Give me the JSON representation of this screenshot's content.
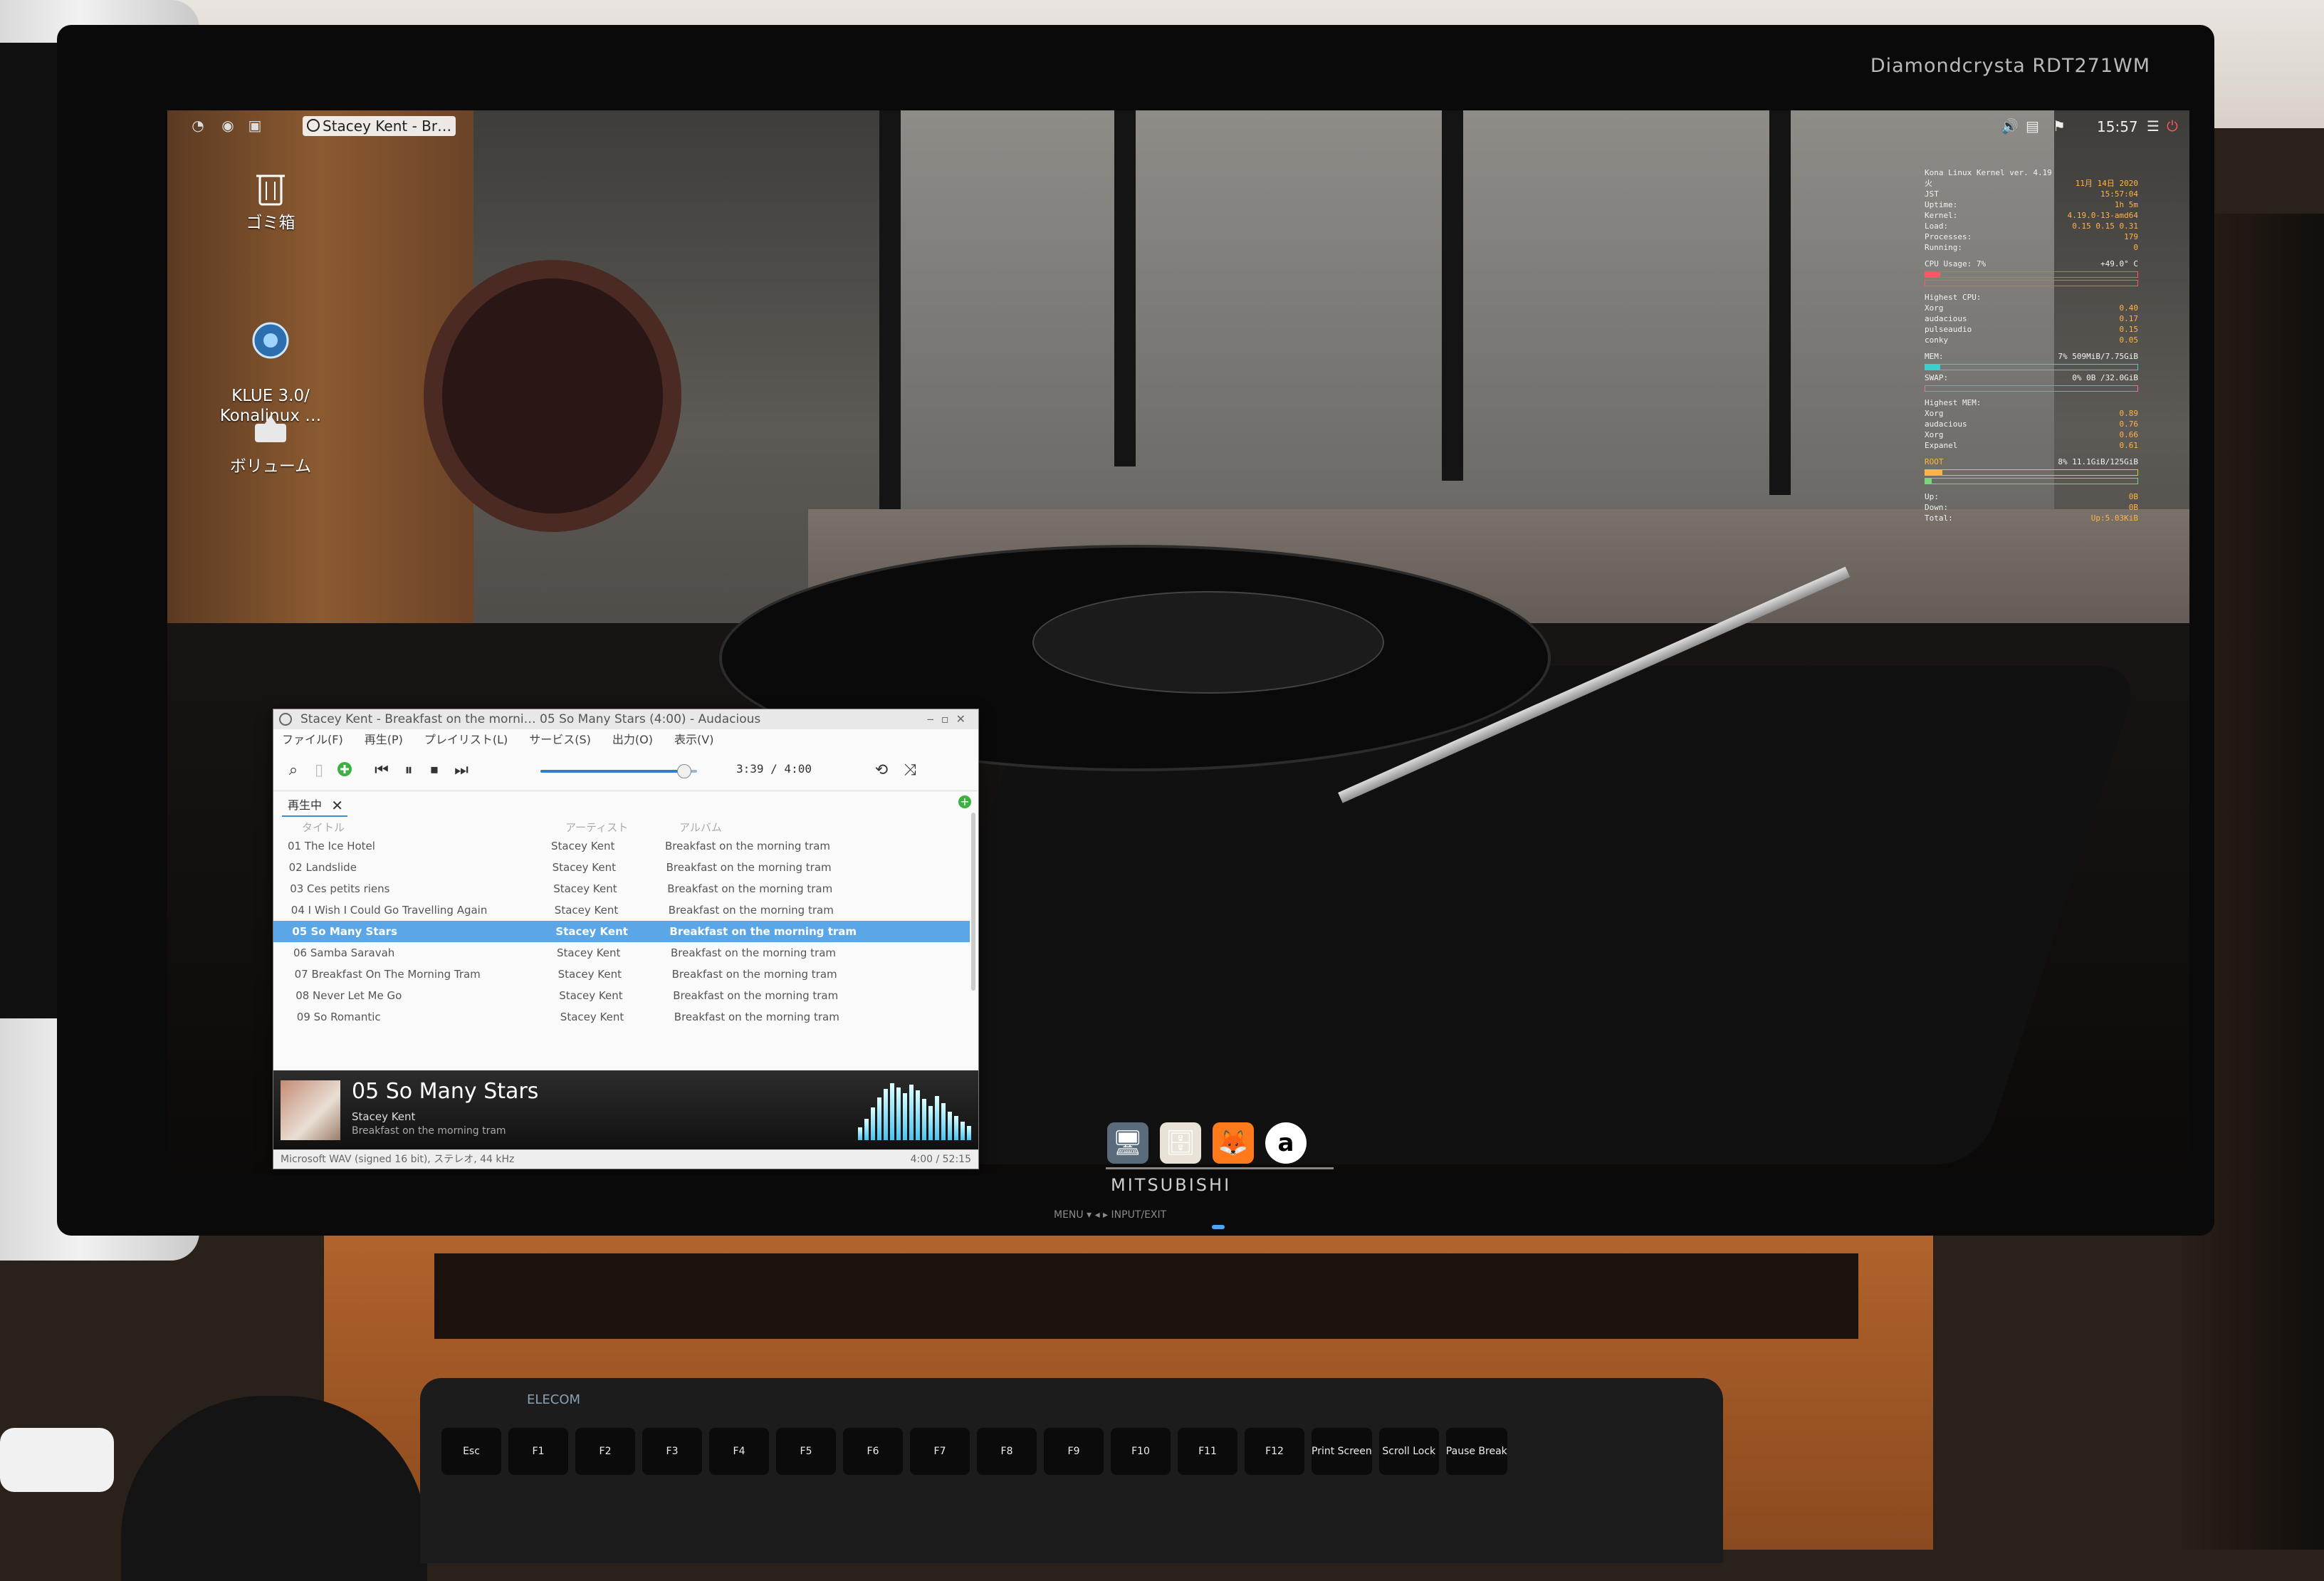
{
  "monitor": {
    "model": "Diamondcrysta RDT271WM",
    "brand": "MITSUBISHI",
    "controls": "MENU ▾   ◂   ▸   INPUT/EXIT"
  },
  "taskbar": {
    "task_button_label": "Stacey Kent - Br…",
    "clock": "15:57"
  },
  "desktop_icons": [
    {
      "label": "ゴミ箱",
      "icon": "trash-icon"
    },
    {
      "label": "KLUE 3.0/\nKonalinux …",
      "icon": "klue-icon"
    },
    {
      "label": "ボリューム",
      "icon": "volume-drive-icon"
    }
  ],
  "conky": {
    "header": "Kona Linux Kernel ver. 4.19",
    "rows": [
      {
        "k": "火",
        "v": "11月 14日 2020"
      },
      {
        "k": "JST",
        "v": "15:57:04"
      },
      {
        "k": "Uptime:",
        "v": "1h 5m"
      },
      {
        "k": "Kernel:",
        "v": "4.19.0-13-amd64"
      },
      {
        "k": "Load:",
        "v": "0.15 0.15 0.31"
      },
      {
        "k": "Processes:",
        "v": "179"
      },
      {
        "k": "Running:",
        "v": "0"
      }
    ],
    "cpu_label": "CPU Usage: 7%",
    "cpu_temp": "+49.0° C",
    "cpu_usage": 0.07,
    "highest_cpu_label": "Highest CPU:",
    "highest_cpu": [
      {
        "name": "Xorg",
        "v": "0.40"
      },
      {
        "name": "audacious",
        "v": "0.17"
      },
      {
        "name": "pulseaudio",
        "v": "0.15"
      },
      {
        "name": "conky",
        "v": "0.05"
      }
    ],
    "mem_label": "MEM:",
    "mem_value": "7% 509MiB/7.75GiB",
    "mem_usage": 0.07,
    "swap_label": "SWAP:",
    "swap_value": "0% 0B /32.0GiB",
    "swap_usage": 0.0,
    "highest_mem_label": "Highest MEM:",
    "highest_mem": [
      {
        "name": "Xorg",
        "v": "0.89"
      },
      {
        "name": "audacious",
        "v": "0.76"
      },
      {
        "name": "Xorg",
        "v": "0.66"
      },
      {
        "name": "Expanel",
        "v": "0.61"
      }
    ],
    "disk_label": "ROOT",
    "disk_value": "8% 11.1GiB/125GiB",
    "disk_usage": 0.08,
    "net_rows": [
      {
        "k": "Up:",
        "v": "0B"
      },
      {
        "k": "Down:",
        "v": "0B"
      },
      {
        "k": "Total:",
        "v": "Up:5.03KiB"
      }
    ]
  },
  "dock": [
    {
      "name": "monitor",
      "glyph": "🖥"
    },
    {
      "name": "files",
      "glyph": "🗄"
    },
    {
      "name": "firefox",
      "glyph": "🦊"
    },
    {
      "name": "anydesk",
      "glyph": "a"
    }
  ],
  "audacious": {
    "window_title": "Stacey Kent - Breakfast on the morni… 05 So Many Stars (4:00) - Audacious",
    "menu": [
      "ファイル(F)",
      "再生(P)",
      "プレイリスト(L)",
      "サービス(S)",
      "出力(O)",
      "表示(V)"
    ],
    "time_display": "3:39 / 4:00",
    "progress": 0.9125,
    "tab_label": "再生中",
    "columns": {
      "title": "タイトル",
      "artist": "アーティスト",
      "album": "アルバム"
    },
    "tracks": [
      {
        "title": "01 The Ice Hotel",
        "artist": "Stacey Kent",
        "album": "Breakfast on the morning tram"
      },
      {
        "title": "02 Landslide",
        "artist": "Stacey Kent",
        "album": "Breakfast on the morning tram"
      },
      {
        "title": "03 Ces petits riens",
        "artist": "Stacey Kent",
        "album": "Breakfast on the morning tram"
      },
      {
        "title": "04 I Wish I Could Go Travelling Again",
        "artist": "Stacey Kent",
        "album": "Breakfast on the morning tram"
      },
      {
        "title": "05 So Many Stars",
        "artist": "Stacey Kent",
        "album": "Breakfast on the morning tram",
        "selected": true
      },
      {
        "title": "06 Samba Saravah",
        "artist": "Stacey Kent",
        "album": "Breakfast on the morning tram"
      },
      {
        "title": "07 Breakfast On The Morning Tram",
        "artist": "Stacey Kent",
        "album": "Breakfast on the morning tram"
      },
      {
        "title": "08 Never Let Me Go",
        "artist": "Stacey Kent",
        "album": "Breakfast on the morning tram"
      },
      {
        "title": "09 So Romantic",
        "artist": "Stacey Kent",
        "album": "Breakfast on the morning tram"
      }
    ],
    "now_playing": {
      "title": "05 So Many Stars",
      "artist": "Stacey Kent",
      "album": "Breakfast on the morning tram"
    },
    "status_left": "Microsoft WAV (signed 16 bit), ステレオ, 44 kHz",
    "status_right": "4:00 / 52:15",
    "visualizer": [
      18,
      30,
      46,
      60,
      72,
      80,
      74,
      66,
      78,
      70,
      58,
      48,
      62,
      52,
      40,
      34,
      26,
      20
    ]
  },
  "keyboard": {
    "brand": "ELECOM",
    "keys": [
      "Esc",
      "F1",
      "F2",
      "F3",
      "F4",
      "F5",
      "F6",
      "F7",
      "F8",
      "F9",
      "F10",
      "F11",
      "F12",
      "Print Screen",
      "Scroll Lock",
      "Pause Break"
    ]
  }
}
